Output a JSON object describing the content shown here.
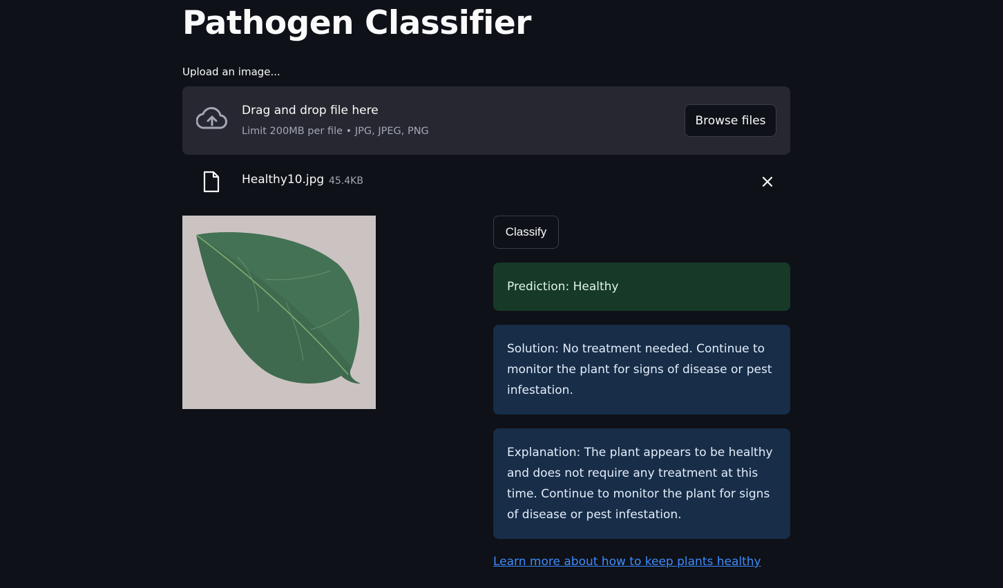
{
  "page": {
    "title": "Pathogen Classifier"
  },
  "uploader": {
    "label": "Upload an image...",
    "drop_title": "Drag and drop file here",
    "drop_subtitle": "Limit 200MB per file • JPG, JPEG, PNG",
    "browse_label": "Browse files",
    "file": {
      "name": "Healthy10.jpg",
      "size": "45.4KB"
    }
  },
  "actions": {
    "classify_label": "Classify"
  },
  "results": {
    "prediction": "Prediction: Healthy",
    "solution": "Solution: No treatment needed. Continue to monitor the plant for signs of disease or pest infestation.",
    "explanation": "Explanation: The plant appears to be healthy and does not require any treatment at this time. Continue to monitor the plant for signs of disease or pest infestation."
  },
  "link": {
    "text": "Learn more about how to keep plants healthy"
  },
  "colors": {
    "background": "#0e1117",
    "surface": "#262730",
    "success": "#173928",
    "info": "#172d48",
    "link": "#3d8bfd"
  },
  "icons": [
    "cloud-upload-icon",
    "file-icon",
    "close-icon"
  ]
}
